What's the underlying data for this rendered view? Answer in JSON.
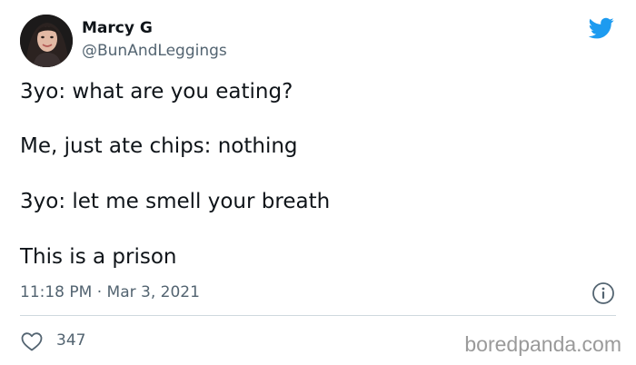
{
  "author": {
    "name": "Marcy G",
    "handle": "@BunAndLeggings"
  },
  "tweet": {
    "lines": [
      "3yo: what are you eating?",
      "Me, just ate chips: nothing",
      "3yo: let me smell your breath",
      "This is a prison"
    ],
    "timestamp": "11:18 PM · Mar 3, 2021",
    "likes": "347"
  },
  "watermark": "boredpanda.com",
  "icons": {
    "logo": "twitter-bird-icon",
    "info": "info-icon",
    "like": "heart-icon"
  },
  "colors": {
    "brand": "#1d9bf0",
    "text": "#0f1419",
    "secondary": "#536471",
    "divider": "#cfd9de",
    "watermark": "#9a9a9a"
  }
}
